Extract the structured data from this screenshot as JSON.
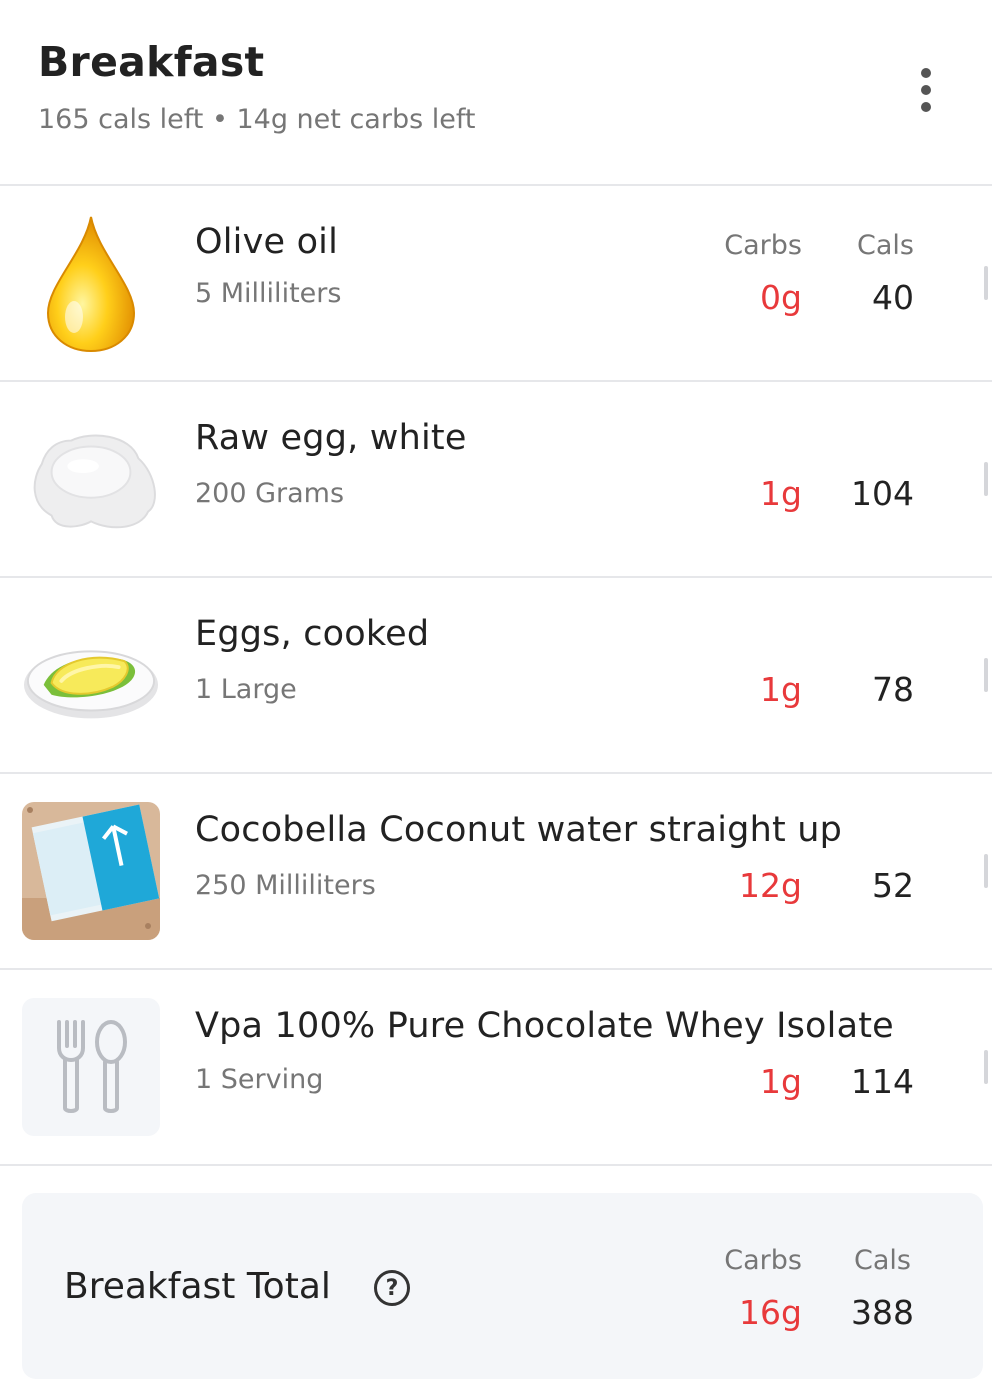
{
  "header": {
    "title": "Breakfast",
    "subtitle": "165 cals left • 14g net carbs left",
    "menu_icon": "more-vertical-icon"
  },
  "columns": {
    "carbs": "Carbs",
    "cals": "Cals"
  },
  "foods": [
    {
      "name": "Olive oil",
      "serving": "5 Milliliters",
      "carbs": "0g",
      "cals": "40",
      "image": "olive-oil-drop"
    },
    {
      "name": "Raw egg, white",
      "serving": "200 Grams",
      "carbs": "1g",
      "cals": "104",
      "image": "raw-egg-white"
    },
    {
      "name": "Eggs, cooked",
      "serving": "1 Large",
      "carbs": "1g",
      "cals": "78",
      "image": "omelette-plate"
    },
    {
      "name": "Cocobella Coconut water straight up",
      "serving": "250 Milliliters",
      "carbs": "12g",
      "cals": "52",
      "image": "coconut-water-carton-photo"
    },
    {
      "name": "Vpa 100% Pure Chocolate Whey Isolate",
      "serving": "1 Serving",
      "carbs": "1g",
      "cals": "114",
      "image": "fork-spoon-placeholder-icon"
    }
  ],
  "total": {
    "label": "Breakfast Total",
    "carbs_label": "Carbs",
    "cals_label": "Cals",
    "carbs": "16g",
    "cals": "388",
    "help_icon": "help-circle-icon"
  },
  "colors": {
    "carbs": "#e8393b",
    "muted_text": "#767676",
    "divider": "#e6e7ea",
    "total_bg": "#f4f6f9"
  }
}
